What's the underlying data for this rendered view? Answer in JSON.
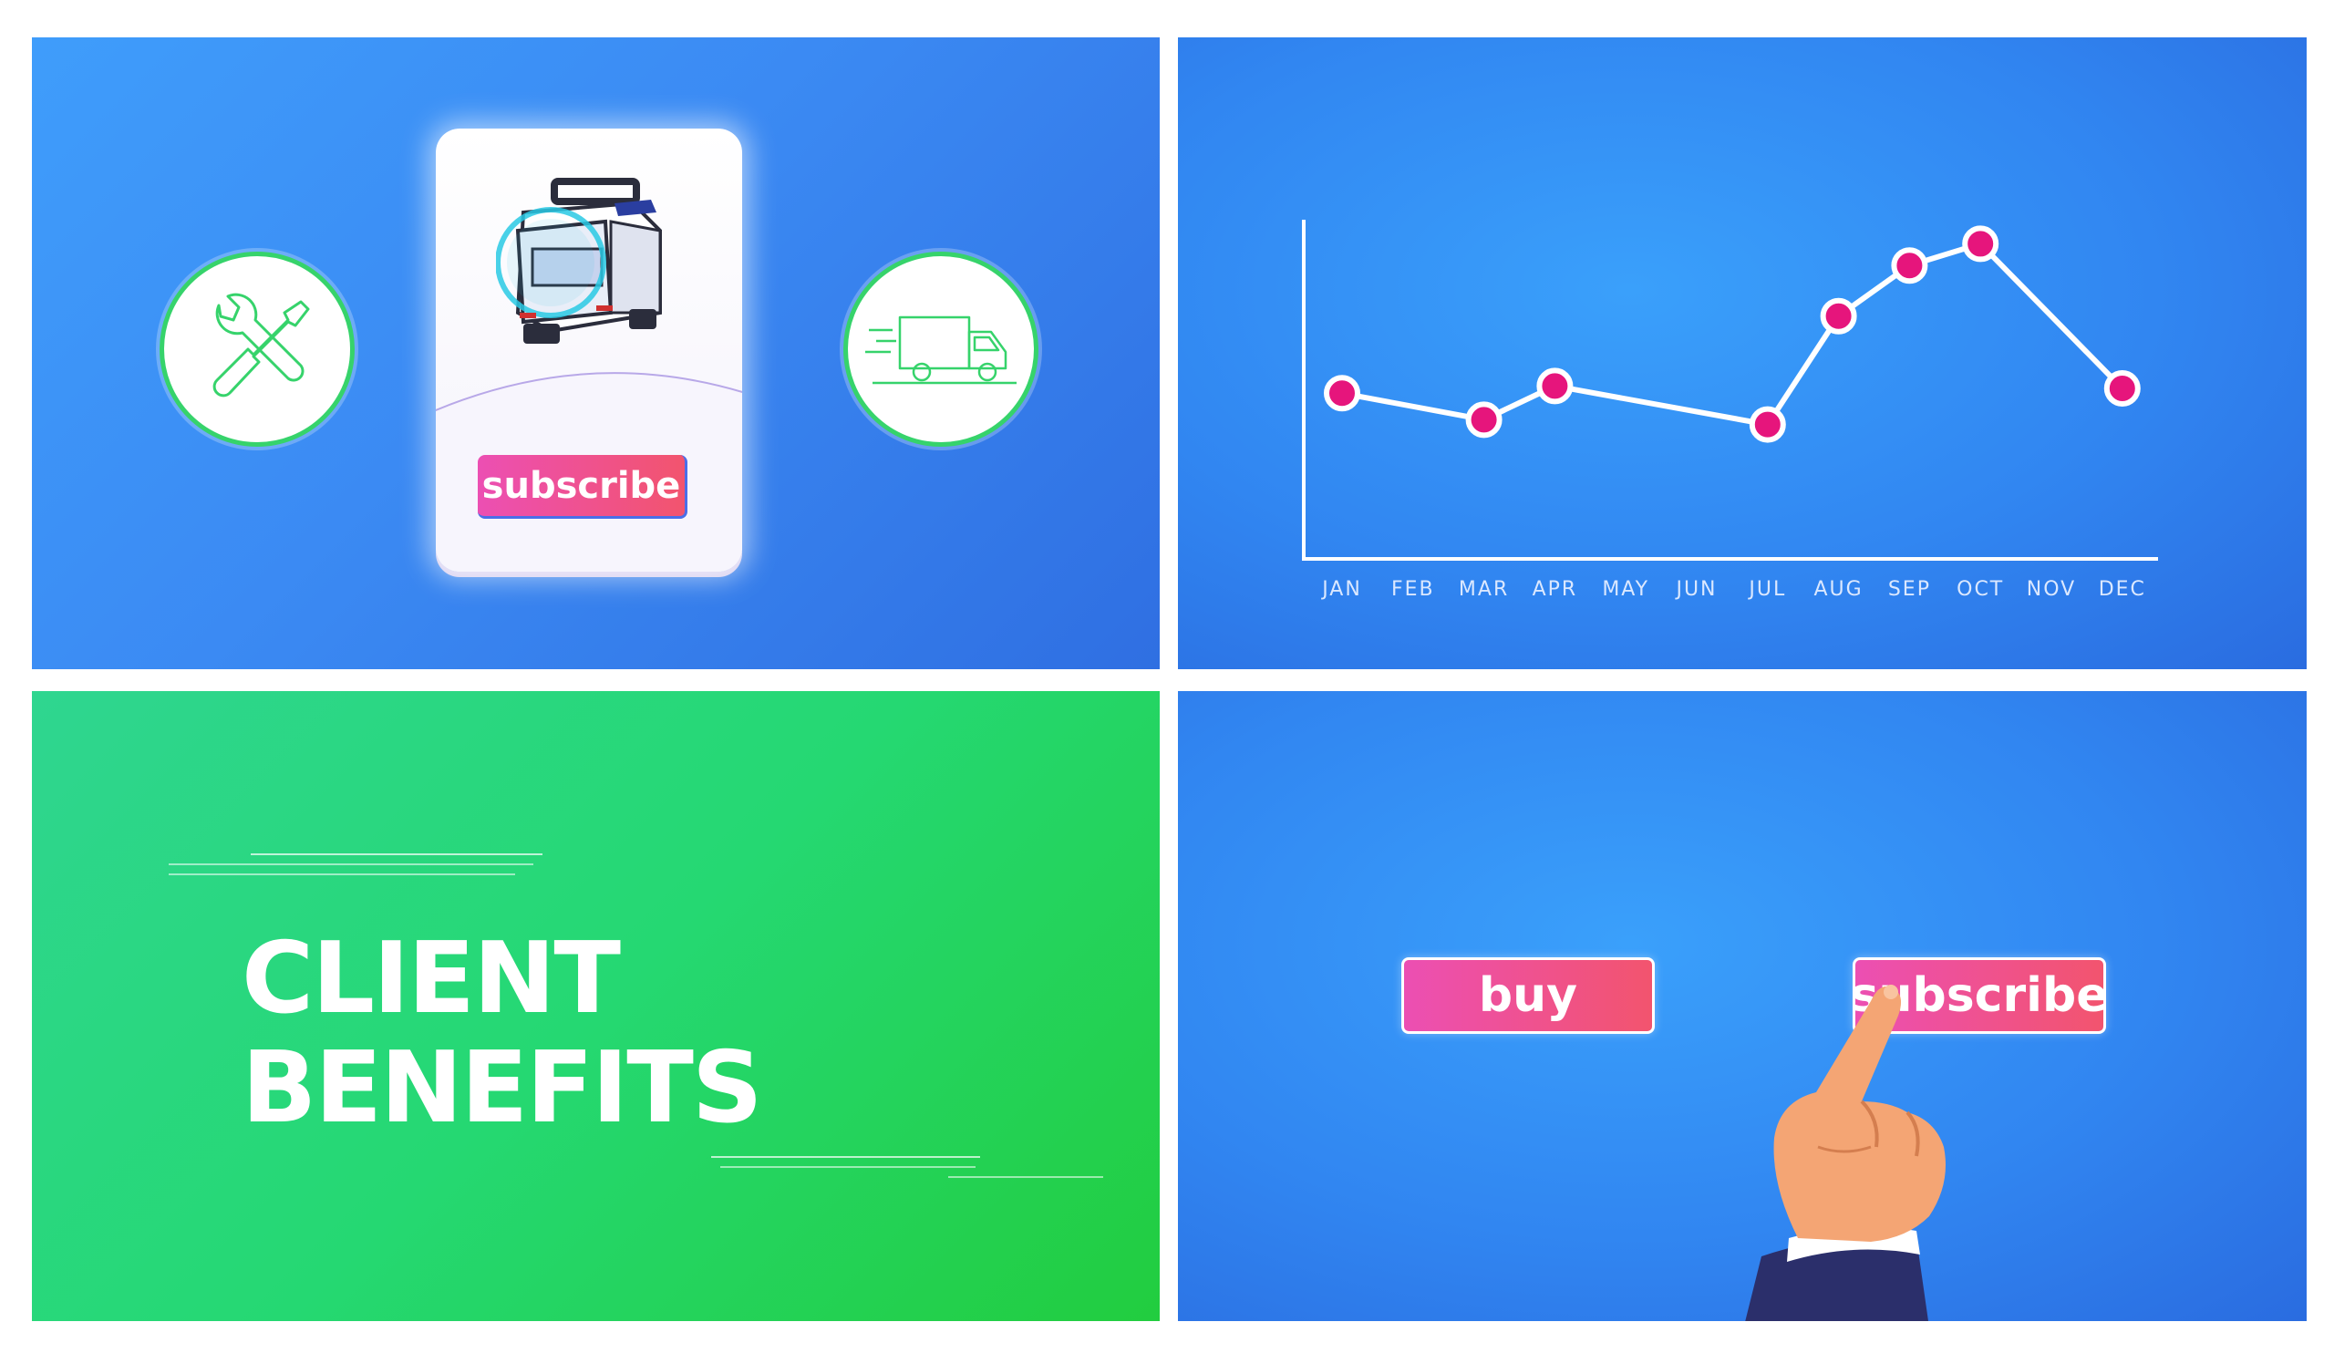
{
  "panel_top_left": {
    "card_button": "subscribe",
    "left_icon": "wrench-screwdriver-icon",
    "right_icon": "delivery-truck-icon",
    "product_icon": "isometric-van-icon"
  },
  "panel_top_right": {
    "chart_data": {
      "type": "line",
      "categories": [
        "JAN",
        "FEB",
        "MAR",
        "APR",
        "MAY",
        "JUN",
        "JUL",
        "AUG",
        "SEP",
        "OCT",
        "NOV",
        "DEC"
      ],
      "points": [
        {
          "x": "JAN",
          "y": 38
        },
        {
          "x": "MAR",
          "y": 27
        },
        {
          "x": "APR",
          "y": 41
        },
        {
          "x": "JUL",
          "y": 25
        },
        {
          "x": "AUG",
          "y": 70
        },
        {
          "x": "SEP",
          "y": 91
        },
        {
          "x": "OCT",
          "y": 100
        },
        {
          "x": "DEC",
          "y": 40
        }
      ],
      "ylim": [
        -30,
        110
      ],
      "line_color": "#ffffff",
      "marker_color": "#e6157c",
      "grid": false,
      "title": "",
      "xlabel": "",
      "ylabel": ""
    }
  },
  "panel_bottom_left": {
    "title_line_1": "CLIENT",
    "title_line_2": "BENEFITS"
  },
  "panel_bottom_right": {
    "buy_label": "buy",
    "subscribe_label": "subscribe",
    "hand_icon": "pointing-hand-icon"
  },
  "colors": {
    "blue_background": "#3b8af3",
    "green_background": "#25d872",
    "button_gradient_start": "#ec4fb3",
    "button_gradient_end": "#f2546e",
    "circle_border": "#36d36b"
  }
}
